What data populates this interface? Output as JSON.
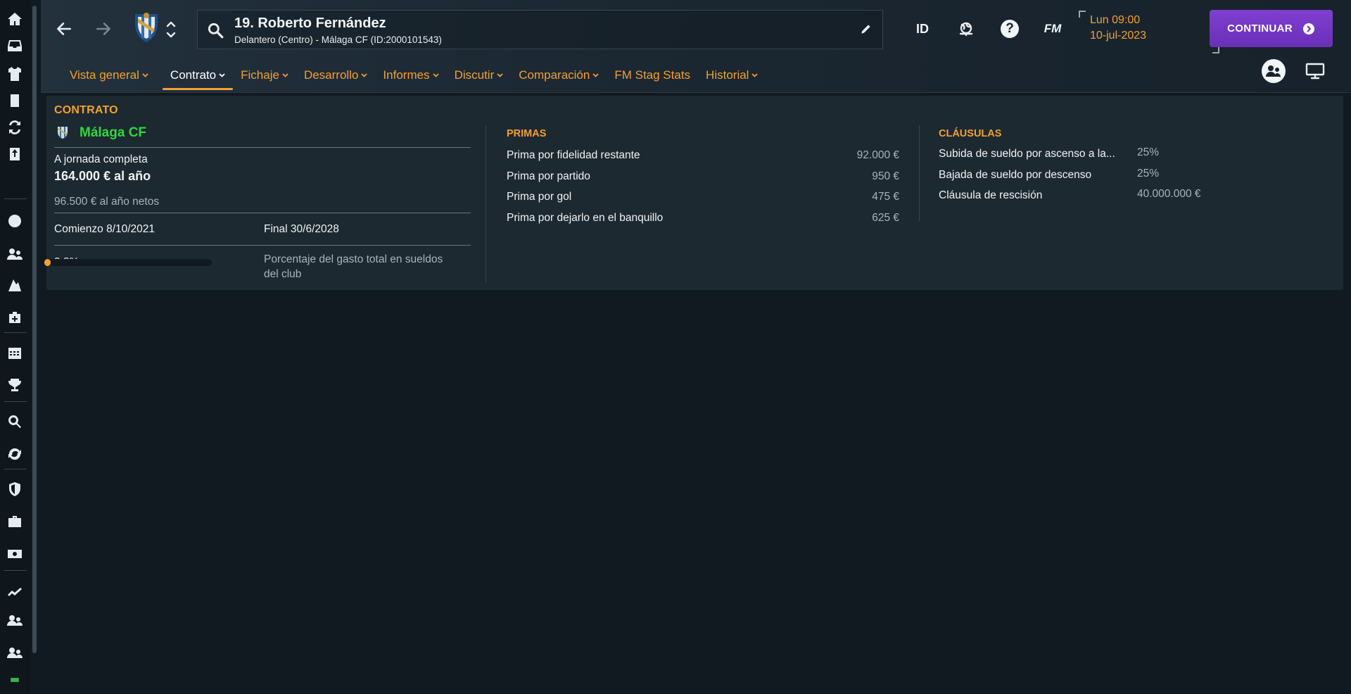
{
  "header": {
    "player_title": "19. Roberto Fernández",
    "player_subtitle": "Delantero (Centro) - Málaga CF (ID:2000101543)",
    "id_label": "ID",
    "fm_label": "FM",
    "help_label": "?",
    "date_day": "Lun 09:00",
    "date_date": "10-jul-2023",
    "continue_label": "CONTINUAR"
  },
  "tabs": [
    {
      "label": "Vista general",
      "dropdown": true
    },
    {
      "label": "Contrato",
      "dropdown": true,
      "active": true
    },
    {
      "label": "Fichaje",
      "dropdown": true
    },
    {
      "label": "Desarrollo",
      "dropdown": true
    },
    {
      "label": "Informes",
      "dropdown": true
    },
    {
      "label": "Discutir",
      "dropdown": true
    },
    {
      "label": "Comparación",
      "dropdown": true
    },
    {
      "label": "FM Stag Stats",
      "dropdown": false
    },
    {
      "label": "Historial",
      "dropdown": true
    }
  ],
  "contract": {
    "title": "CONTRATO",
    "club": "Málaga CF",
    "type": "A jornada completa",
    "salary": "164.000 € al año",
    "net": "96.500 € al año netos",
    "start": "Comienzo 8/10/2021",
    "end": "Final 30/6/2028",
    "wage_percent_label": "3.8%",
    "wage_percent_value": 3.8,
    "wage_desc_1": "Porcentaje del gasto total en sueldos",
    "wage_desc_2": "del club"
  },
  "bonuses": {
    "title": "PRIMAS",
    "rows": [
      {
        "label": "Prima por fidelidad restante",
        "value": "92.000 €"
      },
      {
        "label": "Prima por partido",
        "value": "950 €"
      },
      {
        "label": "Prima por gol",
        "value": "475 €"
      },
      {
        "label": "Prima por dejarlo en el banquillo",
        "value": "625 €"
      }
    ]
  },
  "clauses": {
    "title": "CLÁUSULAS",
    "rows": [
      {
        "label": "Subida de sueldo por ascenso a la...",
        "value": "25%"
      },
      {
        "label": "Bajada de sueldo por descenso",
        "value": "25%"
      },
      {
        "label": "Cláusula de rescisión",
        "value": "40.000.000 €"
      }
    ]
  },
  "colors": {
    "accent": "#f3a033",
    "club_green": "#32d742",
    "continue_purple": "#7f3fd0"
  },
  "sidebar_icons": [
    "home-icon",
    "inbox-icon",
    "squad-icon",
    "tactics-icon",
    "transfers-icon",
    "training-icon",
    "ball-icon",
    "staff-icon",
    "scouting-icon",
    "medical-icon",
    "calendar-icon",
    "trophy-icon",
    "search-icon",
    "refresh-icon",
    "club-shield-icon",
    "briefcase-icon",
    "finances-icon",
    "chart-icon",
    "u19-icon",
    "reserve-icon",
    "currency-icon"
  ]
}
